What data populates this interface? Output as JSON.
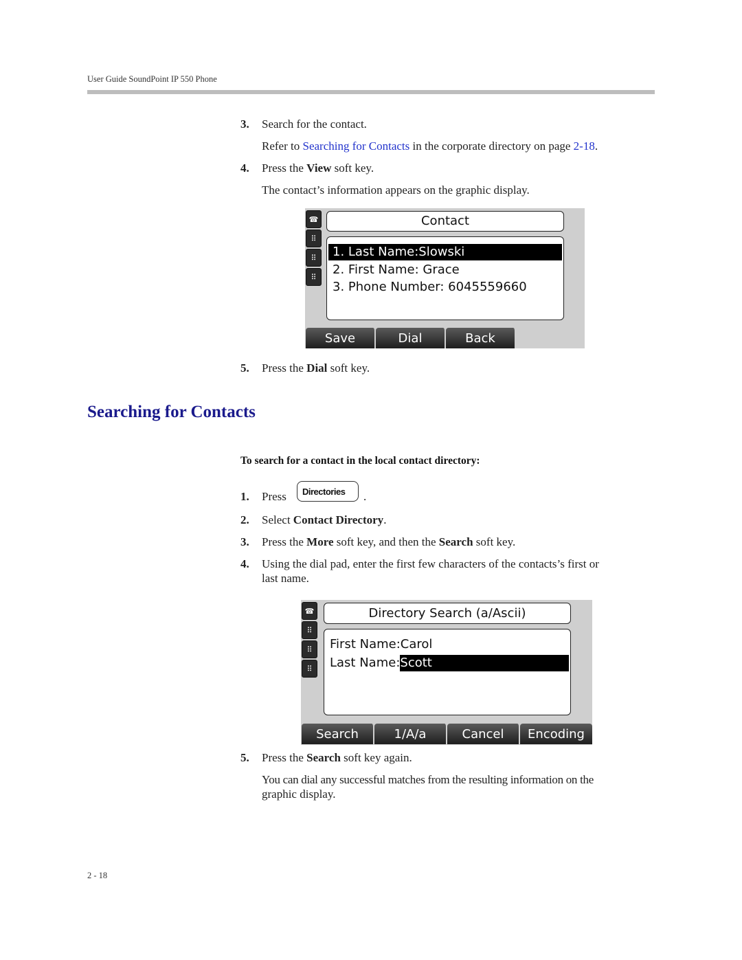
{
  "header": {
    "running_title": "User Guide SoundPoint IP 550 Phone"
  },
  "section1": {
    "steps": [
      {
        "num": "3.",
        "text": "Search for the contact."
      },
      {
        "num": "4.",
        "pre": "Press the ",
        "bold": "View",
        "post": " soft key."
      },
      {
        "num": "5.",
        "pre": "Press the ",
        "bold": "Dial",
        "post": " soft key."
      }
    ],
    "refer": {
      "pre": "Refer to ",
      "link": "Searching for Contacts",
      "mid": " in the corporate directory on page ",
      "page_link": "2-18",
      "post": "."
    },
    "info_text": "The contact’s information appears on the graphic display."
  },
  "screen1": {
    "title": "Contact",
    "lines": [
      "1. Last Name:Slowski",
      "2. First Name: Grace",
      "3. Phone Number: 6045559660"
    ],
    "selected_index": 0,
    "softkeys": [
      "Save",
      "Dial",
      "Back"
    ]
  },
  "section2": {
    "heading": "Searching for Contacts",
    "procedure_heading": "To search for a contact in the local contact directory:",
    "steps": [
      {
        "num": "1.",
        "pre": "Press ",
        "key_label": "Directories",
        "post": "."
      },
      {
        "num": "2.",
        "pre": "Select ",
        "bold": "Contact Directory",
        "post": "."
      },
      {
        "num": "3.",
        "pre": "Press the ",
        "bold": "More",
        "mid": " soft key, and then the ",
        "bold2": "Search",
        "post": " soft key."
      },
      {
        "num": "4.",
        "line1": "Using the dial pad, enter the first few characters of the contacts’s first or",
        "line2": "last name."
      },
      {
        "num": "5.",
        "pre": "Press the ",
        "bold": "Search",
        "post": " soft key again."
      }
    ],
    "result_text_line1": "You can dial any successful matches from the resulting information on the",
    "result_text_line2": "graphic display."
  },
  "screen2": {
    "title": "Directory Search (a/Ascii)",
    "fields": [
      {
        "label": "First Name:",
        "value": "Carol"
      },
      {
        "label": "Last Name:",
        "value": "Scott"
      }
    ],
    "selected_field": 1,
    "softkeys": [
      "Search",
      "1/A/a",
      "Cancel",
      "Encoding"
    ]
  },
  "footer": {
    "page_number": "2 - 18"
  }
}
